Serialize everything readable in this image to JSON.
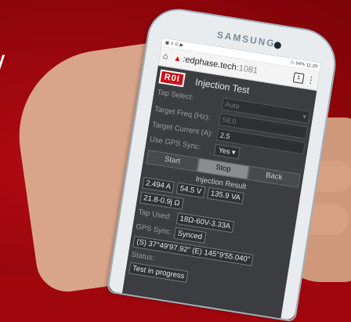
{
  "phone": {
    "brand": "SAMSUNG",
    "status_left": "▣ ≡ ⊙ ▶",
    "status_right": "⚠ 94% 11:29",
    "url": ":edphase.tech",
    "url_port": ":1081",
    "tabs_count": "1"
  },
  "app": {
    "logo": "R0I",
    "title": "Injection Test",
    "tap_select_label": "Tap Select:",
    "tap_select_value": "Auto",
    "target_freq_label": "Target Freq (Hz):",
    "target_freq_value": "58.0",
    "target_current_label": "Target Current (A):",
    "target_current_value": "2.5",
    "gps_sync_label": "Use GPS Sync:",
    "gps_sync_value": "Yes",
    "start_label": "Start",
    "stop_label": "Stop",
    "back_label": "Back",
    "result_title": "Injection Result",
    "current": "2.494 A",
    "voltage": "54.5 V",
    "power": "135.9 VA",
    "impedance": "21.8-0.9j Ω",
    "tap_used_label": "Tap Used:",
    "tap_used_value": "18Ω-60V-3.33A",
    "gps_status_label": "GPS Sync:",
    "gps_status_value": "Synced",
    "coordinates": "(S) 37°49'97.92\" (E) 145°9'55.040\"",
    "status_label": "Status:",
    "status_value": "Test in progress"
  }
}
